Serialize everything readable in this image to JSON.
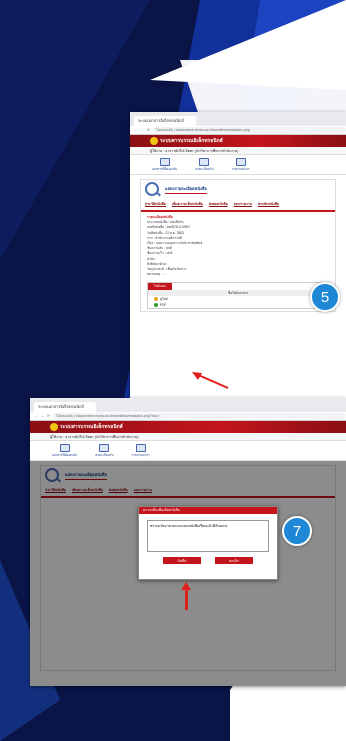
{
  "colors": {
    "navy": "#0a1446",
    "blue": "#12309a",
    "brand_red": "#c4151c",
    "badge_blue": "#1e88d6"
  },
  "screenshot_step5": {
    "browser_tab": "ระบบเอกสารอิเล็กทรอนิกส์",
    "address": "ไม่ปลอดภัย | edocument.rmutsv.ac.th/workflow/readdocs.php",
    "app_title": "ระบบสารบรรณอิเล็กทรอนิกส์",
    "user_line": "ผู้ใช้งาน : อาจารย์ปวีณ์ จิตตะ (นักวิชาการศึกษา/สำนักงาน)",
    "icons": [
      "เอกสารที่ต้องลงรับ",
      "ลงทะเบียนรับ",
      "รายงานต่างๆ"
    ],
    "doc_title": "แสดงรายละเอียดหนังสือ",
    "subtabs": [
      "ประวัติหนังสือ",
      "เพิ่มความเห็นหนังสือ",
      "ส่งต่อหนังสือ",
      "ออกรายงาน",
      "ส่งกลับหนังสือ"
    ],
    "info_heading": "รายละเอียดหนังสือ",
    "info_rows": [
      "ประเภทหนังสือ : หนังสือรับ",
      "เลขที่หนังสือ : ศธ0578.1/ว9907",
      "วันที่หนังสือ : 22 ต.ค. 2563",
      "จาก : สำนักงานอธิการบดี",
      "เรื่อง : ขอความอนุเคราะห์ประชาสัมพันธ์",
      "ชั้นความลับ : ปกติ",
      "ชั้นความเร็ว : ปกติ",
      "คำสั่ง :",
      "สิ่งที่ส่งมาด้วย :",
      "วัตถุประสงค์ : เพื่อดำเนินการ",
      "หมายเหตุ : ..."
    ],
    "badge": "5",
    "attach_tab": "ไฟล์แนบ",
    "attach_header": "ชื่อไฟล์เอกสาร",
    "files": [
      "ดูไฟล์",
      "PDF"
    ]
  },
  "screenshot_step7": {
    "browser_tab": "ระบบเอกสารอิเล็กทรอนิกส์",
    "address": "ไม่ปลอดภัย | edocument.rmutsv.ac.th/workflow/readdocs.php?dov=",
    "app_title": "ระบบสารบรรณอิเล็กทรอนิกส์",
    "user_line": "ผู้ใช้งาน : อาจารย์ปวีณ์ จิตตะ (นักวิชาการศึกษา/สำนักงาน)",
    "icons": [
      "เอกสารที่ต้องลงรับ",
      "ลงทะเบียนรับ",
      "รายงานต่างๆ"
    ],
    "doc_title": "แสดงรายละเอียดหนังสือ",
    "modal_title": "ความเห็นเพิ่มเติมหนังสือ",
    "comment_value": "ทราบแจ้งมาตามและแนบหนังสือเรียนแล้วมีตัวอย่าง",
    "save_label": "บันทึก",
    "cancel_label": "ยกเลิก",
    "badge": "7"
  }
}
